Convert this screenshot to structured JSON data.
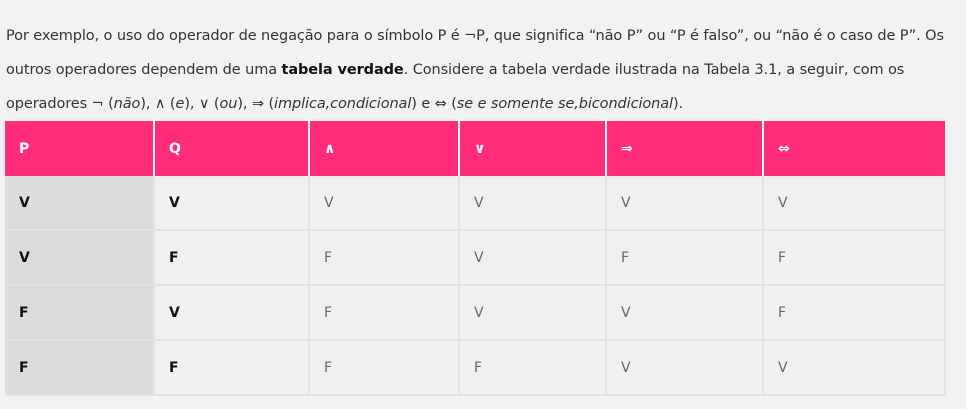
{
  "paragraph": {
    "t1": "Por exemplo, o uso do operador de negação para o símbolo P é ¬P, que significa “não P” ou “P é falso”, ou “não é o caso de P”. Os outros operadores dependem de uma ",
    "bold": "tabela verdade",
    "t2": ". Considere a tabela verdade ilustrada na Tabela 3.1, a seguir, com os operadores ¬ (",
    "i1": "não",
    "t3": "), ∧ (",
    "i2": "e",
    "t4": "), ∨ (",
    "i3": "ou",
    "t5": "), ⇒ (",
    "i4": "implica,condicional",
    "t6": ") e ⇔ (",
    "i5": "se e somente se,bicondicional",
    "t7": ")."
  },
  "table": {
    "headers": [
      "P",
      "Q",
      "∧",
      "∨",
      "⇒",
      "⇔"
    ],
    "rows": [
      [
        "V",
        "V",
        "V",
        "V",
        "V",
        "V"
      ],
      [
        "V",
        "F",
        "F",
        "V",
        "F",
        "F"
      ],
      [
        "F",
        "V",
        "F",
        "V",
        "V",
        "F"
      ],
      [
        "F",
        "F",
        "F",
        "F",
        "V",
        "V"
      ]
    ]
  },
  "colors": {
    "header_bg": "#ff2d78",
    "header_text": "#ffffff",
    "first_col_bg": "#dcdcdc",
    "cell_bg": "#f0f0f0"
  }
}
